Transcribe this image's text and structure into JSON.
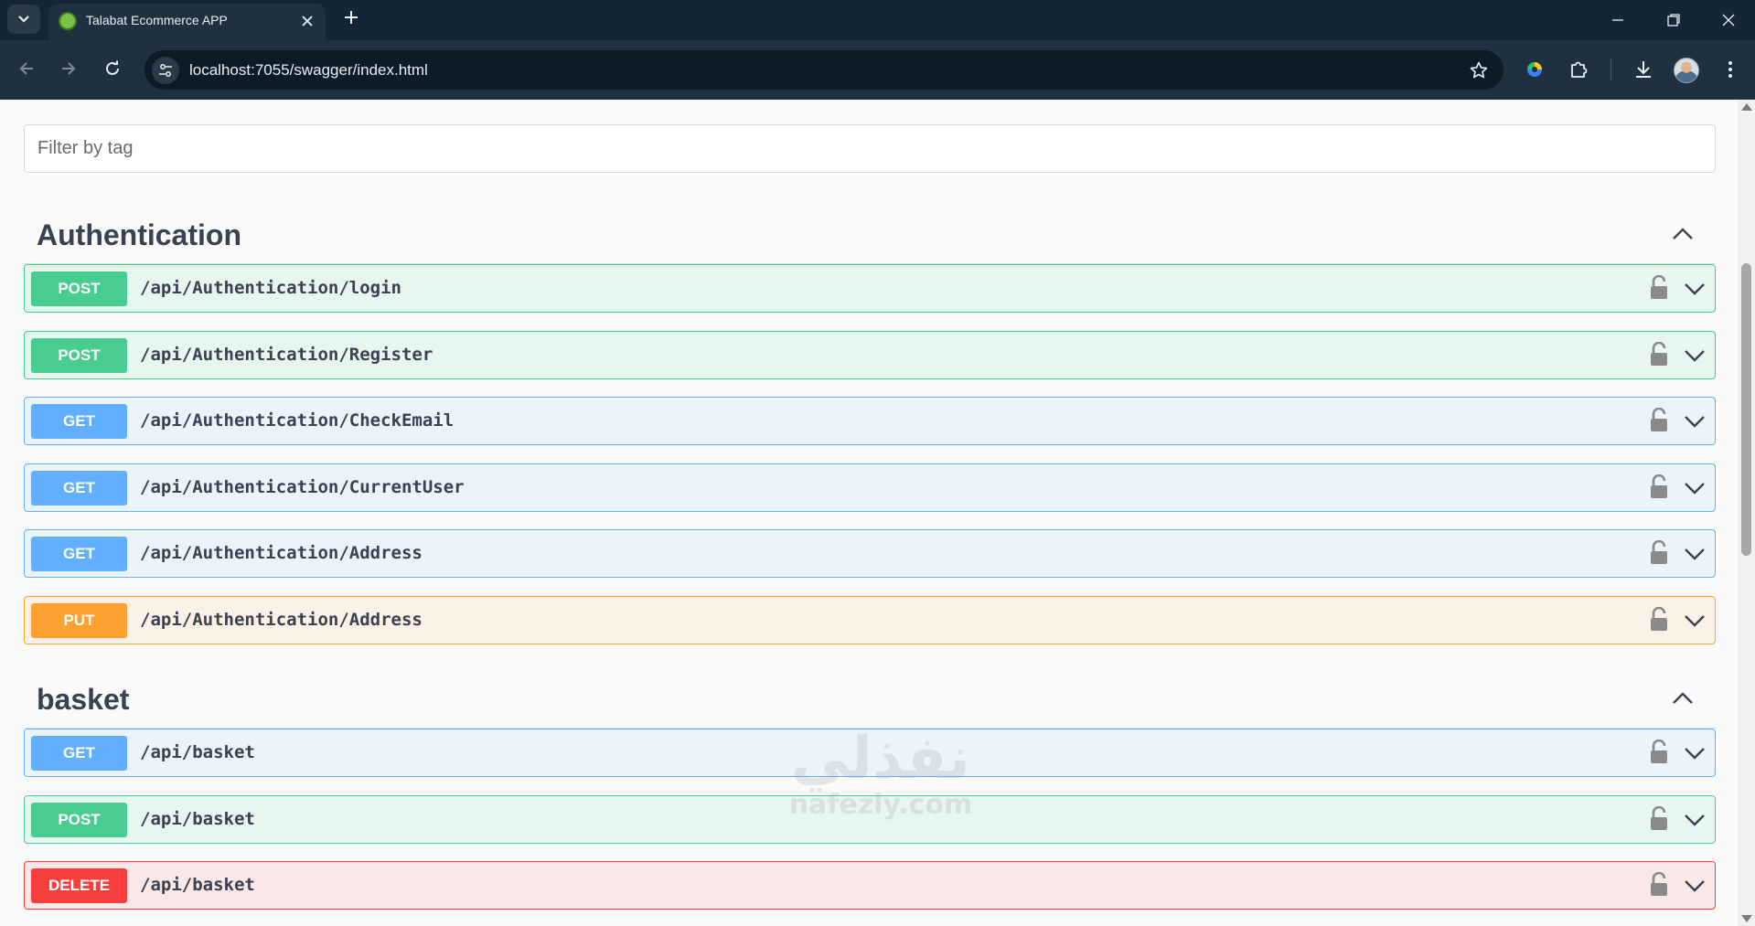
{
  "browser": {
    "tab_title": "Talabat Ecommerce APP",
    "url": "localhost:7055/swagger/index.html"
  },
  "filter": {
    "placeholder": "Filter by tag"
  },
  "sections": {
    "authentication": {
      "title": "Authentication",
      "ops": [
        {
          "method": "POST",
          "path": "/api/Authentication/login"
        },
        {
          "method": "POST",
          "path": "/api/Authentication/Register"
        },
        {
          "method": "GET",
          "path": "/api/Authentication/CheckEmail"
        },
        {
          "method": "GET",
          "path": "/api/Authentication/CurrentUser"
        },
        {
          "method": "GET",
          "path": "/api/Authentication/Address"
        },
        {
          "method": "PUT",
          "path": "/api/Authentication/Address"
        }
      ]
    },
    "basket": {
      "title": "basket",
      "ops": [
        {
          "method": "GET",
          "path": "/api/basket"
        },
        {
          "method": "POST",
          "path": "/api/basket"
        },
        {
          "method": "DELETE",
          "path": "/api/basket"
        }
      ]
    }
  },
  "method_colors": {
    "POST": "#49cc90",
    "GET": "#61affe",
    "PUT": "#fca130",
    "DELETE": "#f93e3e"
  },
  "watermark": {
    "arabic": "نفذلي",
    "latin": "nafezly.com"
  }
}
